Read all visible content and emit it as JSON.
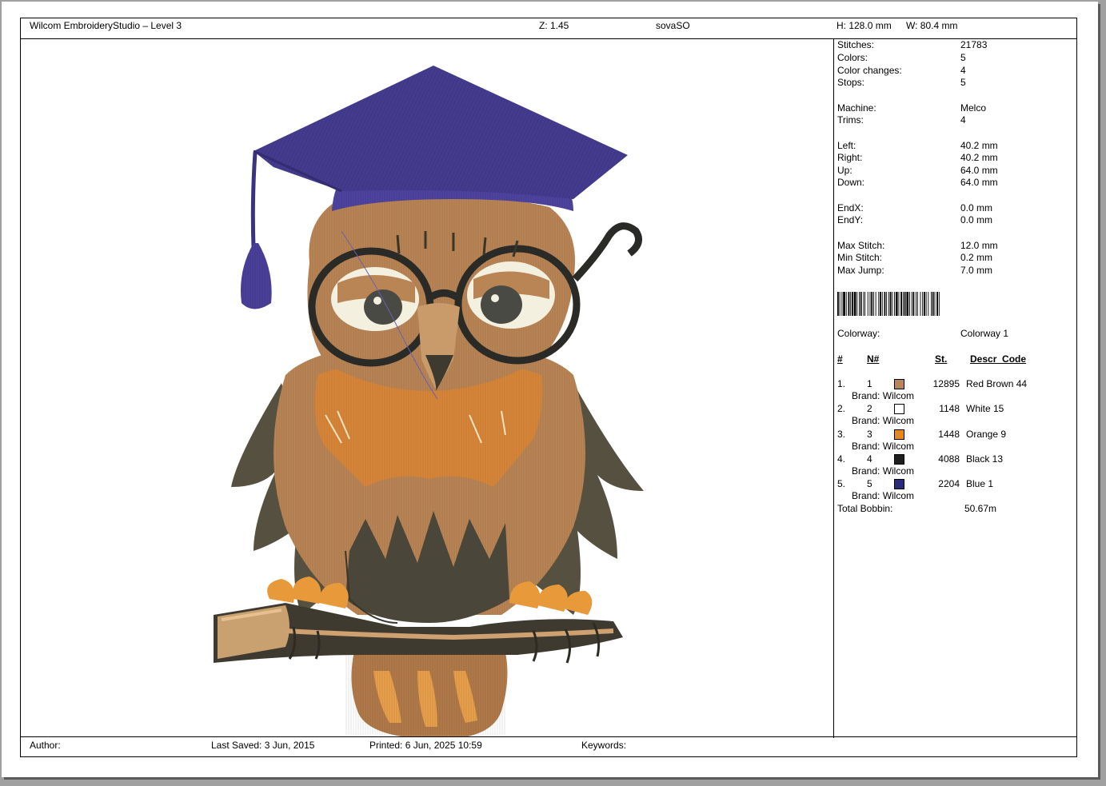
{
  "header": {
    "app_title": "Wilcom EmbroideryStudio – Level 3",
    "zoom": "Z: 1.45",
    "design_name": "sovaSO",
    "height": "H: 128.0 mm",
    "width": "W: 80.4 mm"
  },
  "stats": [
    {
      "label": "Stitches:",
      "value": "21783"
    },
    {
      "label": "Colors:",
      "value": "5"
    },
    {
      "label": "Color changes:",
      "value": "4"
    },
    {
      "label": "Stops:",
      "value": "5"
    },
    {
      "label": "Machine:",
      "value": "Melco"
    },
    {
      "label": "Trims:",
      "value": "4"
    },
    {
      "label": "Left:",
      "value": "40.2 mm"
    },
    {
      "label": "Right:",
      "value": "40.2 mm"
    },
    {
      "label": "Up:",
      "value": "64.0 mm"
    },
    {
      "label": "Down:",
      "value": "64.0 mm"
    },
    {
      "label": "EndX:",
      "value": "0.0 mm"
    },
    {
      "label": "EndY:",
      "value": "0.0 mm"
    },
    {
      "label": "Max Stitch:",
      "value": "12.0 mm"
    },
    {
      "label": "Min Stitch:",
      "value": "0.2 mm"
    },
    {
      "label": "Max Jump:",
      "value": "7.0 mm"
    }
  ],
  "colorway": {
    "label": "Colorway:",
    "value": "Colorway 1"
  },
  "table": {
    "headers": [
      "#",
      "N#",
      "St.",
      "Descr_Code"
    ],
    "rows": [
      {
        "idx": "1.",
        "n": "1",
        "color": "#b8845a",
        "st": "12895",
        "descr": "Red Brown 44",
        "brand": "Brand: Wilcom"
      },
      {
        "idx": "2.",
        "n": "2",
        "color": "#ffffff",
        "st": "1148",
        "descr": "White 15",
        "brand": "Brand: Wilcom"
      },
      {
        "idx": "3.",
        "n": "3",
        "color": "#e8861e",
        "st": "1448",
        "descr": "Orange 9",
        "brand": "Brand: Wilcom"
      },
      {
        "idx": "4.",
        "n": "4",
        "color": "#1e1e1e",
        "st": "4088",
        "descr": "Black 13",
        "brand": "Brand: Wilcom"
      },
      {
        "idx": "5.",
        "n": "5",
        "color": "#2a2a7a",
        "st": "2204",
        "descr": "Blue 1",
        "brand": "Brand: Wilcom"
      }
    ],
    "total_label": "Total Bobbin:",
    "total_value": "50.67m"
  },
  "footer": {
    "author_label": "Author:",
    "last_saved": "Last Saved:  3 Jun, 2015",
    "printed": "Printed:  6 Jun, 2025 10:59",
    "keywords_label": "Keywords:"
  }
}
